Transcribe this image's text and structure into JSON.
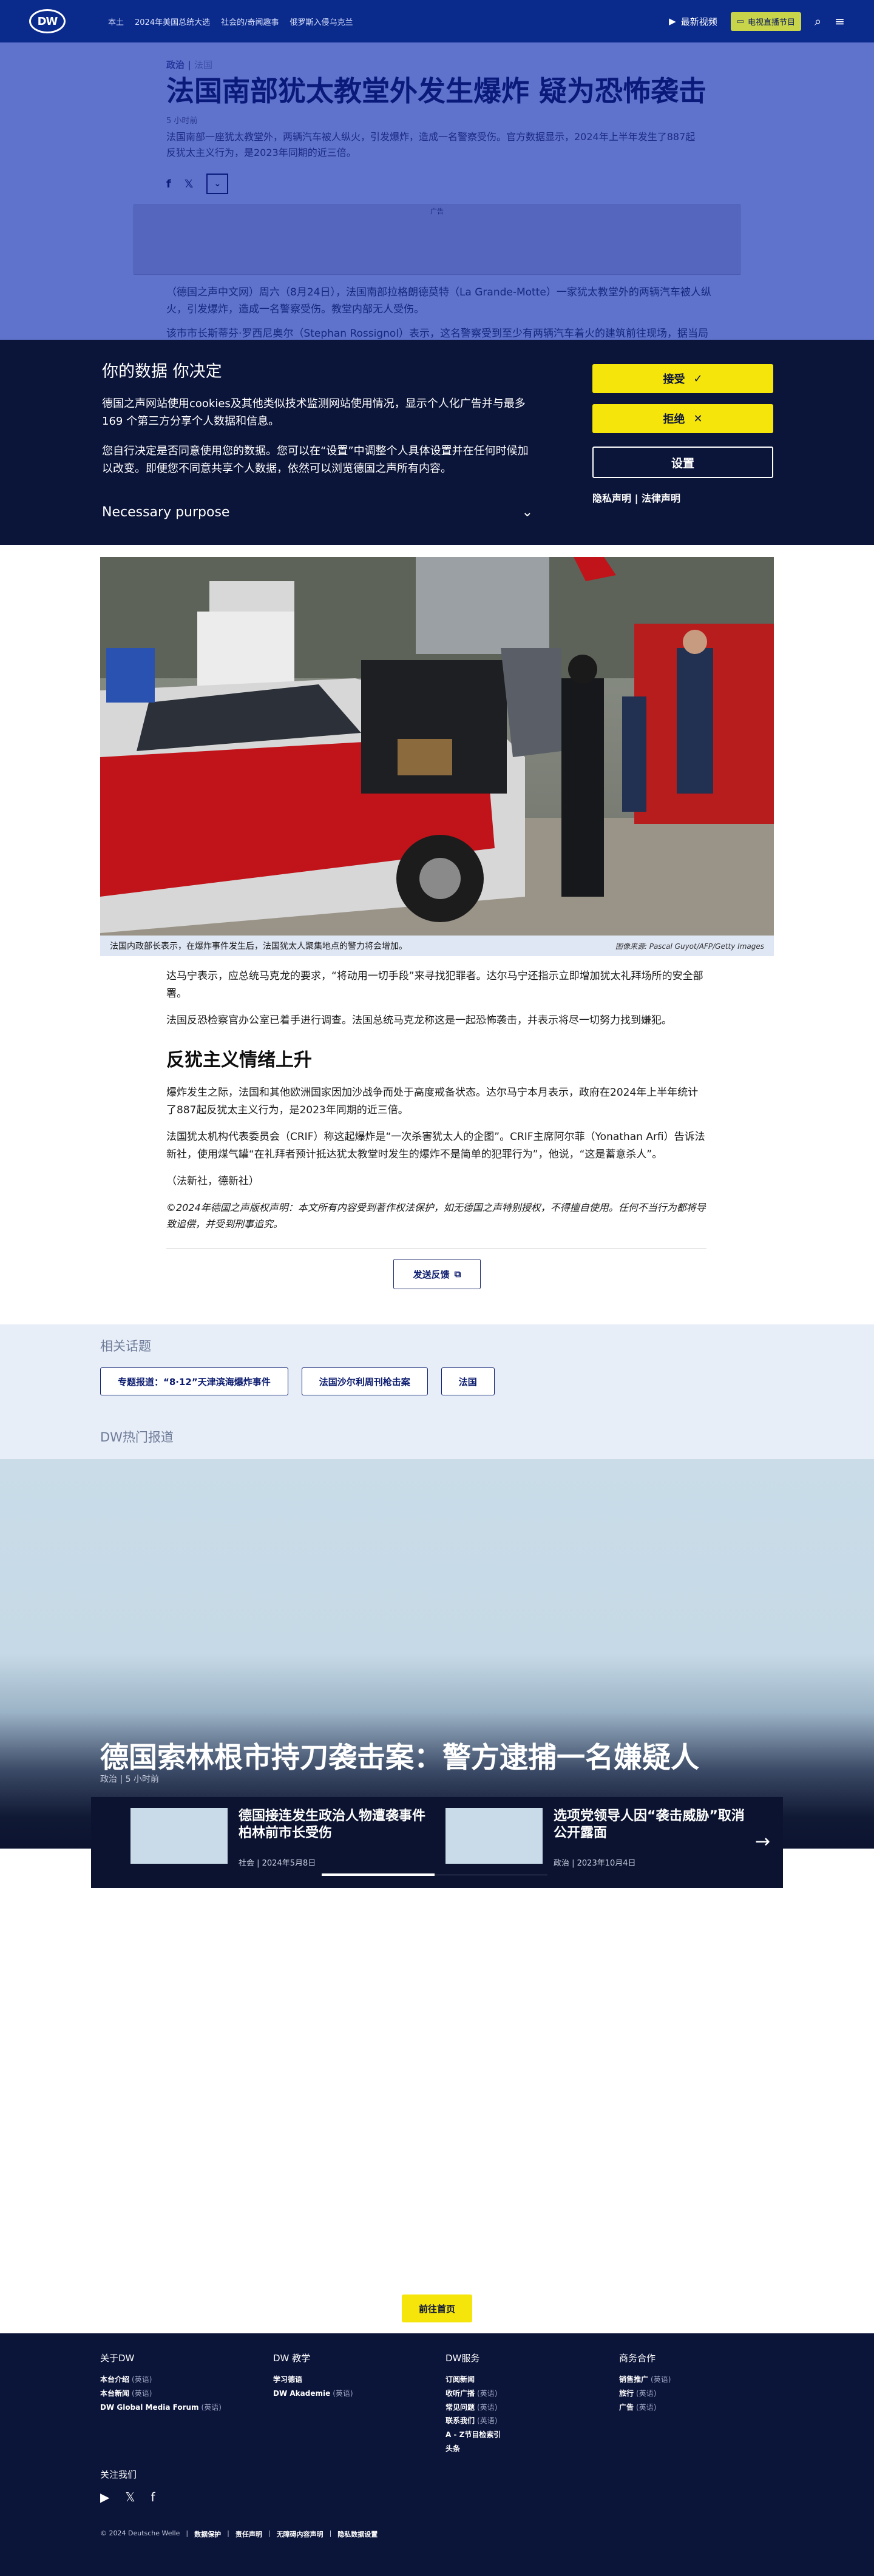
{
  "header": {
    "logo": "DW",
    "nav": [
      "本土",
      "2024年美国总统大选",
      "社会的/奇闻趣事",
      "俄罗斯入侵乌克兰"
    ],
    "live": "最新视频",
    "lang": "电视直播节目",
    "accent": "#0a2a8c"
  },
  "article": {
    "kicker": "政治",
    "kicker_sub": "法国",
    "title": "法国南部犹太教堂外发生爆炸 疑为恐怖袭击",
    "time": "5 小时前",
    "lead": "法国南部一座犹太教堂外，两辆汽车被人纵火，引发爆炸，造成一名警察受伤。官方数据显示，2024年上半年发生了887起反犹太主义行为，是2023年同期的近三倍。",
    "ad_label": "广告",
    "para1": "（德国之声中文网）周六（8月24日），法国南部拉格朗德莫特（La Grande-Motte）一家犹太教堂外的两辆汽车被人纵火，引发爆炸，造成一名警察受伤。教堂内部无人受伤。",
    "para2": "该市市长斯蒂芬·罗西尼奥尔（Stephan Rossignol）表示，这名警察受到至少有两辆汽车着火的建筑前往现场，据当局称",
    "photo_caption": "法国内政部长表示，在爆炸事件发生后，法国犹太人聚集地点的警力将会增加。",
    "photo_credit": "图像来源: Pascal Guyot/AFP/Getty Images",
    "p3": "达马宁表示，应总统马克龙的要求，“将动用一切手段”来寻找犯罪者。达尔马宁还指示立即增加犹太礼拜场所的安全部署。",
    "p4": "法国反恐检察官办公室已着手进行调查。法国总统马克龙称这是一起恐怖袭击，并表示将尽一切努力找到嫌犯。",
    "h2": "反犹主义情绪上升",
    "p5": "爆炸发生之际，法国和其他欧洲国家因加沙战争而处于高度戒备状态。达尔马宁本月表示，政府在2024年上半年统计了887起反犹太主义行为，是2023年同期的近三倍。",
    "p6": "法国犹太机构代表委员会（CRIF）称这起爆炸是“一次杀害犹太人的企图”。CRIF主席阿尔菲（Yonathan Arfi）告诉法新社，使用煤气罐“在礼拜者预计抵达犹太教堂时发生的爆炸不是简单的犯罪行为”，他说，“这是蓄意杀人”。",
    "p7": "（法新社，德新社）",
    "copyright": "©2024年德国之声版权声明：本文所有内容受到著作权法保护，如无德国之声特别授权，不得擅自使用。任何不当行为都将导致追偿，并受到刑事追究。",
    "feedback": "发送反馈"
  },
  "cookie": {
    "title": "你的数据 你决定",
    "p1": "德国之声网站使用cookies及其他类似技术监测网站使用情况，显示个人化广告并与最多169 个第三方分享个人数据和信息。",
    "p2": "您自行决定是否同意使用您的数据。您可以在“设置”中调整个人具体设置并在任何时候加以改变。即便您不同意共享个人数据，依然可以浏览德国之声所有内容。",
    "purpose": "Necessary purpose",
    "accept": "接受",
    "reject": "拒绝",
    "settings": "设置",
    "privacy": "隐私声明",
    "legal": "法律声明",
    "accent": "#f5e50a"
  },
  "related": {
    "label": "相关话题",
    "tags": [
      "专题报道：“8·12”天津滨海爆炸事件",
      "法国沙尔利周刊枪击案",
      "法国"
    ],
    "hot_label": "DW热门报道"
  },
  "hero": {
    "title": "德国索林根市持刀袭击案：警方逮捕一名嫌疑人",
    "meta": "政治 | 5 小时前",
    "cards": [
      {
        "title": "德国接连发生政治人物遭袭事件 柏林前市长受伤",
        "meta": "社会 | 2024年5月8日"
      },
      {
        "title": "选项党领导人因“袭击威胁”取消公开露面",
        "meta": "政治 | 2023年10月4日"
      }
    ]
  },
  "home_button": "前往首页",
  "footer": {
    "cols": [
      {
        "h": "关于DW",
        "items": [
          {
            "t": "本台介绍",
            "l": "(英语)"
          },
          {
            "t": "本台新闻",
            "l": "(英语)"
          },
          {
            "t": "DW Global Media Forum",
            "l": "(英语)"
          }
        ]
      },
      {
        "h": "DW 教学",
        "items": [
          {
            "t": "学习德语",
            "l": ""
          },
          {
            "t": "DW Akademie",
            "l": "(英语)"
          }
        ]
      },
      {
        "h": "DW服务",
        "items": [
          {
            "t": "订阅新闻",
            "l": ""
          },
          {
            "t": "收听广播",
            "l": "(英语)"
          },
          {
            "t": "常见问题",
            "l": "(英语)"
          },
          {
            "t": "联系我们",
            "l": "(英语)"
          },
          {
            "t": "A - Z节目检索引",
            "l": ""
          },
          {
            "t": "头条",
            "l": ""
          }
        ]
      },
      {
        "h": "商务合作",
        "items": [
          {
            "t": "销售推广",
            "l": "(英语)"
          },
          {
            "t": "旅行",
            "l": "(英语)"
          },
          {
            "t": "广告",
            "l": "(英语)"
          }
        ]
      }
    ],
    "follow": "关注我们",
    "copyright": "© 2024 Deutsche Welle",
    "links": [
      "数据保护",
      "责任声明",
      "无障碍内容声明",
      "隐私数据设置"
    ]
  }
}
